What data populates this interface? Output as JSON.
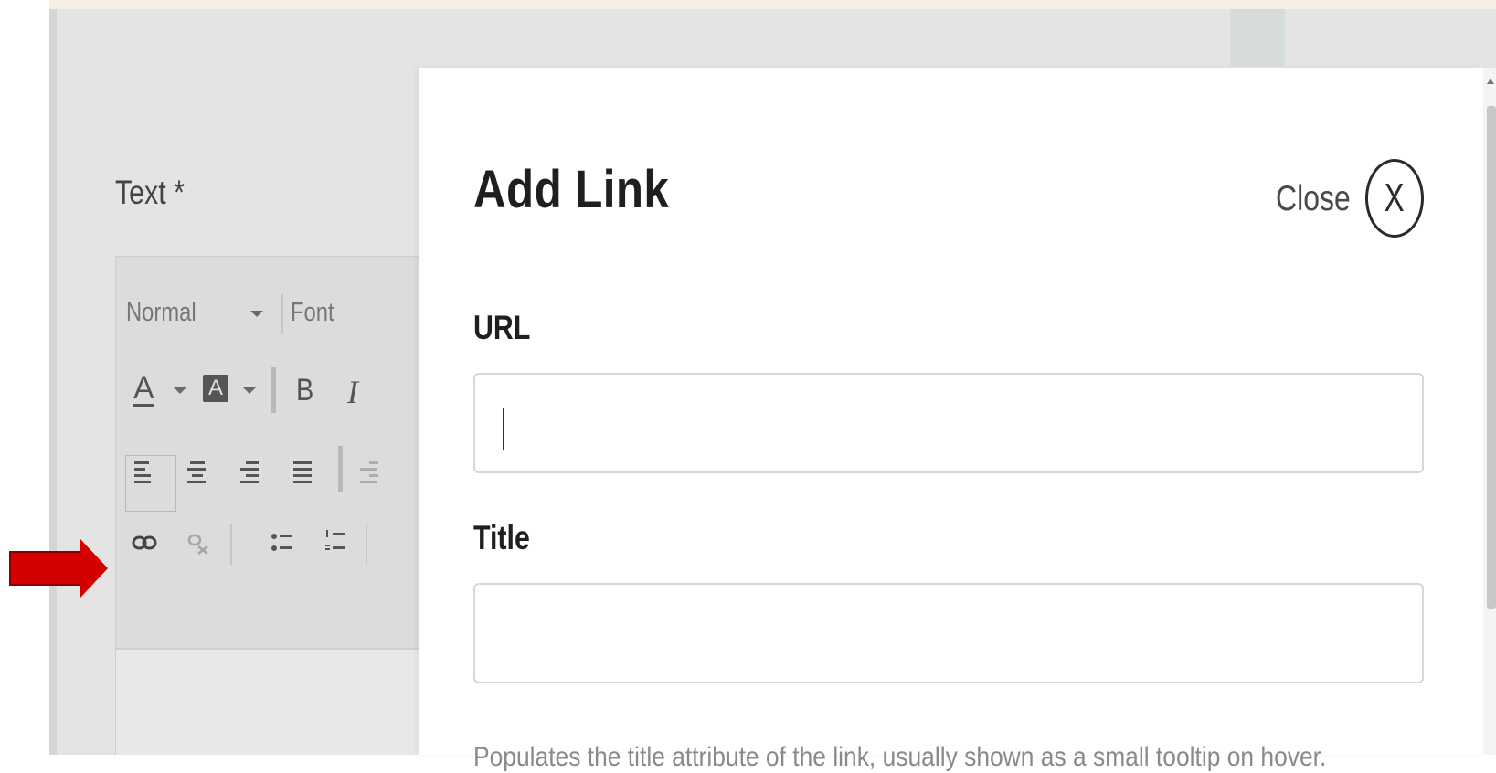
{
  "editor": {
    "field_label": "Text *",
    "toolbar": {
      "format_select": "Normal",
      "font_select": "Font",
      "text_color_glyph": "A",
      "bg_color_glyph": "A",
      "bold_glyph": "B",
      "italic_glyph": "I",
      "icons": [
        "align-left-icon",
        "align-center-icon",
        "align-right-icon",
        "align-justify-icon",
        "indent-icon",
        "link-icon",
        "unlink-icon",
        "bulleted-list-icon",
        "numbered-list-icon"
      ]
    }
  },
  "modal": {
    "title": "Add Link",
    "close_label": "Close",
    "close_glyph": "X",
    "url_label": "URL",
    "url_value": "",
    "title_label": "Title",
    "title_value": "",
    "title_help": "Populates the title attribute of the link, usually shown as a small tooltip on hover."
  },
  "annotation": {
    "arrow_color": "#d40000",
    "points_to": "link-icon"
  },
  "colors": {
    "page_background": "#e4e4e4",
    "modal_background": "#ffffff",
    "input_border": "#d7d7d7"
  }
}
